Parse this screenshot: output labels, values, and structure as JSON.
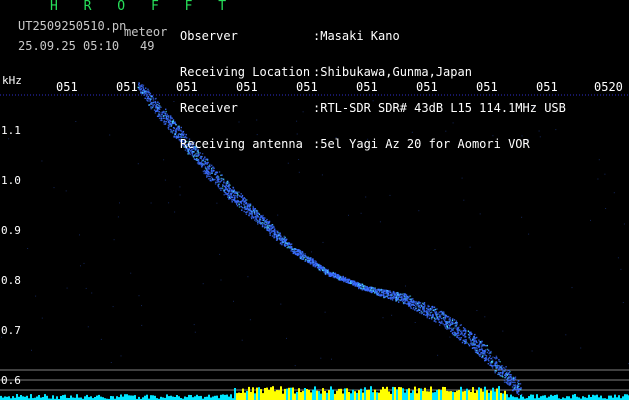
{
  "header": {
    "brand": "H R O F F T",
    "filename": "UT2509250510.pn",
    "tag": "meteor",
    "timestamp": "25.09.25 05:10",
    "count": "49",
    "fields": [
      {
        "label": "Observer",
        "value": ":Masaki Kano"
      },
      {
        "label": "Receiving Location",
        "value": ":Shibukawa,Gunma,Japan"
      },
      {
        "label": "Receiver",
        "value": ":RTL-SDR SDR# 43dB L15 114.1MHz USB"
      },
      {
        "label": "Receiving antenna",
        "value": ":5el Yagi Az 20 for Aomori VOR"
      }
    ]
  },
  "chart_data": {
    "type": "scatter",
    "ylabel": "kHz",
    "y_ticks": [
      "1.1",
      "1.0",
      "0.9",
      "0.8",
      "0.7",
      "0.6"
    ],
    "x_ticks": [
      "051",
      "051",
      "051",
      "051",
      "051",
      "051",
      "051",
      "051",
      "051",
      "0520"
    ],
    "ylim": [
      0.58,
      1.19
    ],
    "grid": false,
    "colors": {
      "signal": "#3a6cff",
      "signal_core": "#4fe3ff",
      "baseline": "#2e2ec8",
      "noise_bar": "#ffff00",
      "noise_bar_alt": "#00e5ff",
      "guide_line": "#b5b5b5"
    },
    "trail": [
      {
        "x": 0.0,
        "khz": 1.18
      },
      {
        "x": 0.1,
        "khz": 1.09
      },
      {
        "x": 0.2,
        "khz": 1.0
      },
      {
        "x": 0.3,
        "khz": 0.93
      },
      {
        "x": 0.4,
        "khz": 0.86
      },
      {
        "x": 0.5,
        "khz": 0.81
      },
      {
        "x": 0.6,
        "khz": 0.78
      },
      {
        "x": 0.7,
        "khz": 0.76
      },
      {
        "x": 0.8,
        "khz": 0.72
      },
      {
        "x": 0.9,
        "khz": 0.66
      },
      {
        "x": 1.0,
        "khz": 0.58
      }
    ]
  }
}
